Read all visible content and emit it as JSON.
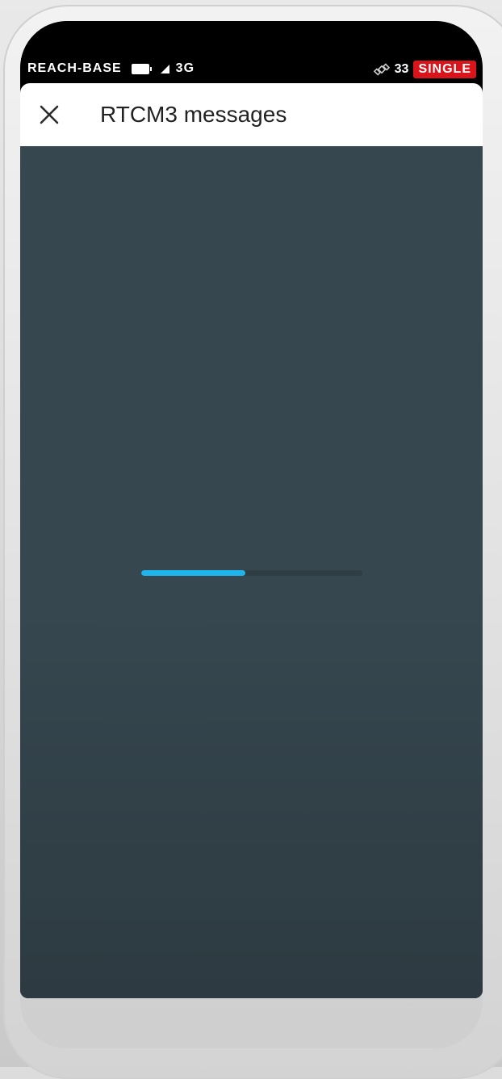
{
  "status_bar": {
    "device_name": "REACH-BASE",
    "network": "3G",
    "satellite_count": "33",
    "solution_mode": "SINGLE"
  },
  "app_bar": {
    "title": "RTCM3 messages",
    "close_icon": "close-icon"
  },
  "loading": {
    "progress_fraction": 0.47,
    "fill_color": "#1eb4ec",
    "track_color": "#2f3d44"
  },
  "colors": {
    "content_background": "#37474f",
    "badge": "#d9141b"
  }
}
